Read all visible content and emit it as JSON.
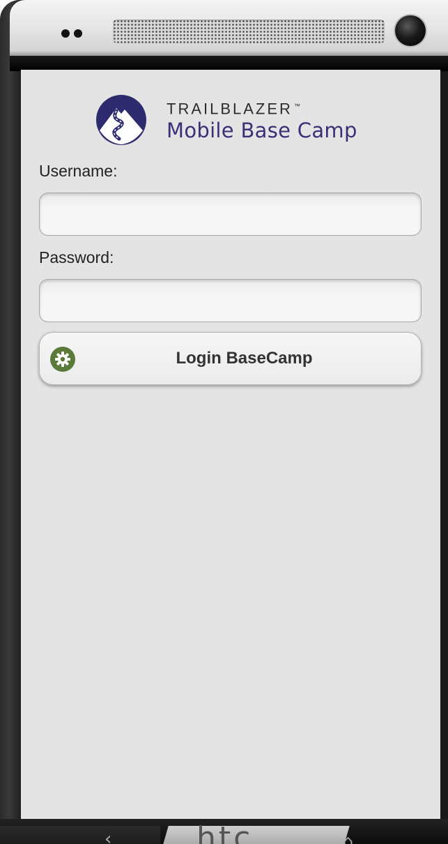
{
  "brand": {
    "name": "TRAILBLAZER",
    "trademark": "™",
    "subtitle": "Mobile Base Camp",
    "logo_icon": "mountain-trail-logo"
  },
  "form": {
    "username_label": "Username:",
    "username_value": "",
    "password_label": "Password:",
    "password_value": ""
  },
  "login_button": {
    "label": "Login BaseCamp",
    "icon": "gear-icon"
  },
  "device": {
    "logo_text": "htc",
    "nav_back_icon": "back-arrow-icon",
    "nav_home_icon": "home-icon"
  },
  "colors": {
    "screen_background": "#e4e4e4",
    "brand_subtitle": "#3a3079",
    "logo_circle": "#2d2a6e",
    "gear_icon": "#5a7a3a"
  }
}
